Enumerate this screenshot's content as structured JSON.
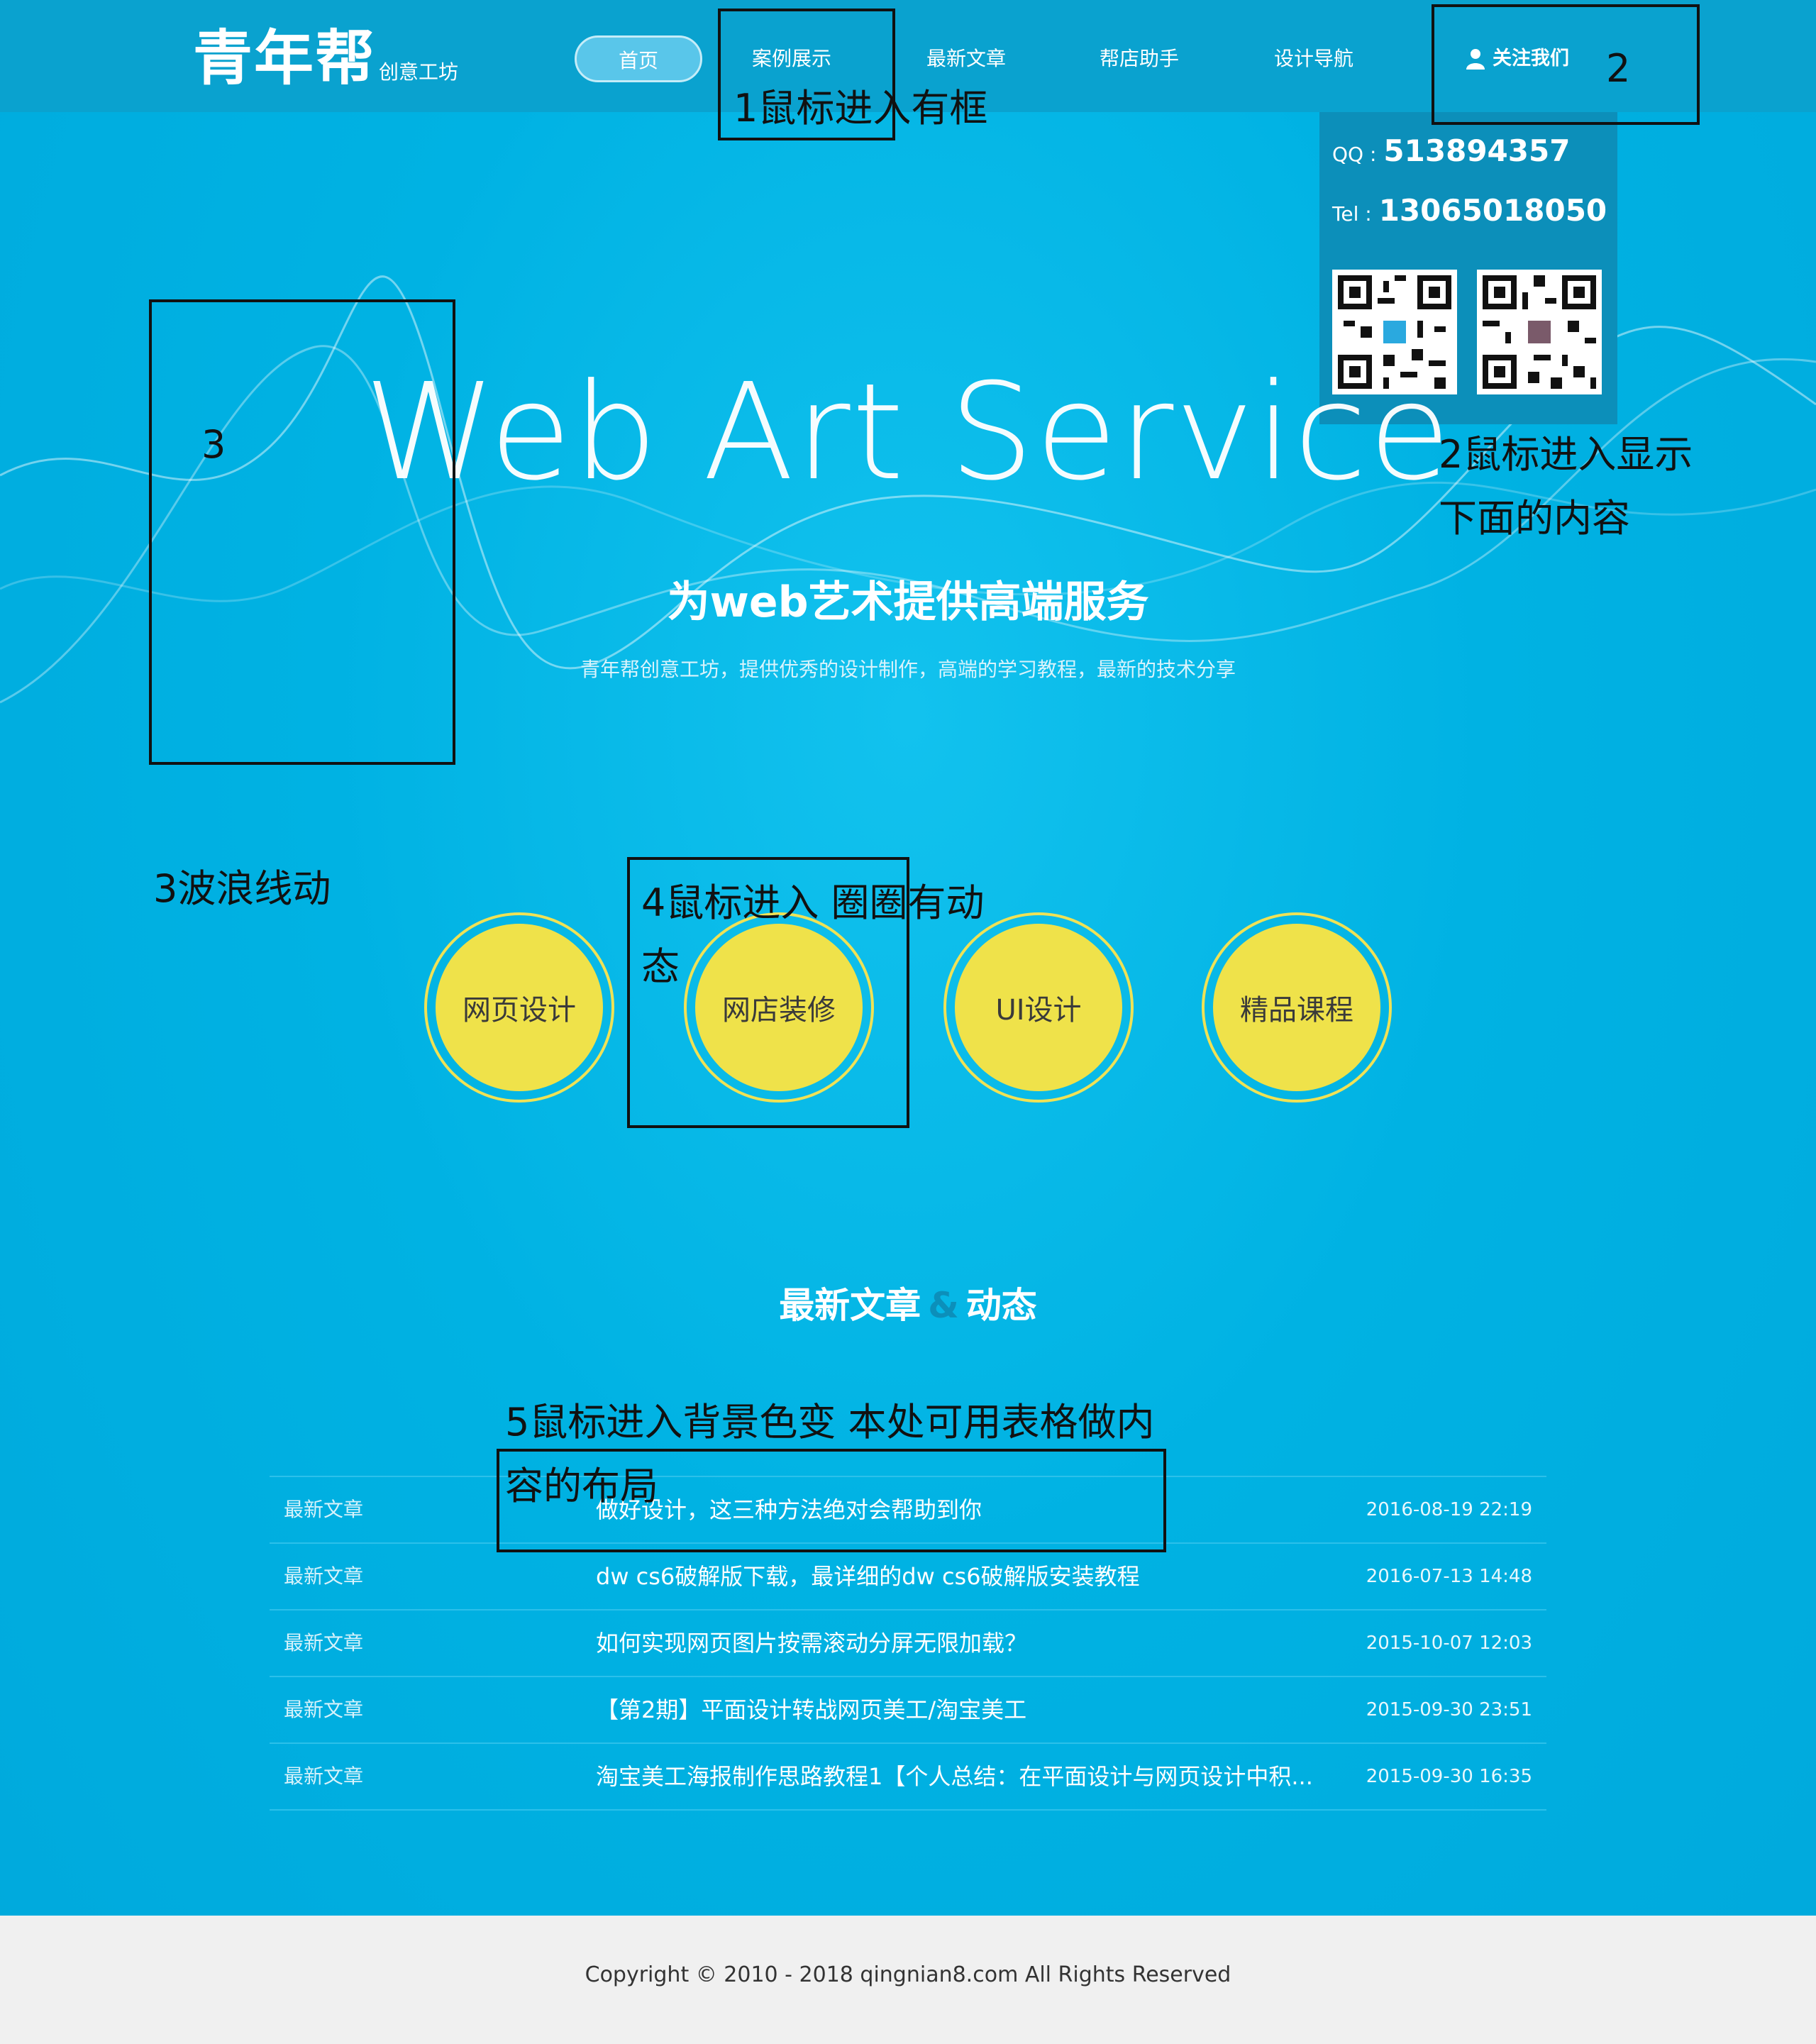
{
  "logo": {
    "main": "青年帮",
    "sub": "创意工坊"
  },
  "nav": [
    {
      "label": "首页"
    },
    {
      "label": "案例展示"
    },
    {
      "label": "最新文章"
    },
    {
      "label": "帮店助手"
    },
    {
      "label": "设计导航"
    }
  ],
  "follow": {
    "label": "关注我们",
    "icon": "user-icon"
  },
  "popup": {
    "qq_label": "QQ :",
    "qq": "513894357",
    "tel_label": "Tel :",
    "tel": "13065018050"
  },
  "hero": {
    "title": "Web Art Service",
    "subtitle": "为web艺术提供高端服务",
    "desc": "青年帮创意工坊，提供优秀的设计制作，高端的学习教程，最新的技术分享"
  },
  "circles": [
    {
      "label": "网页设计"
    },
    {
      "label": "网店装修"
    },
    {
      "label": "UI设计"
    },
    {
      "label": "精品课程"
    }
  ],
  "section": {
    "title_left": "最新文章",
    "amp": "&",
    "title_right": "动态"
  },
  "articles": [
    {
      "cat": "最新文章",
      "title": "做好设计，这三种方法绝对会帮助到你",
      "date": "2016-08-19 22:19"
    },
    {
      "cat": "最新文章",
      "title": "dw cs6破解版下载，最详细的dw cs6破解版安装教程",
      "date": "2016-07-13 14:48"
    },
    {
      "cat": "最新文章",
      "title": "如何实现网页图片按需滚动分屏无限加载？",
      "date": "2015-10-07 12:03"
    },
    {
      "cat": "最新文章",
      "title": "【第2期】平面设计转战网页美工/淘宝美工",
      "date": "2015-09-30 23:51"
    },
    {
      "cat": "最新文章",
      "title": "淘宝美工海报制作思路教程1【个人总结：在平面设计与网页设计中积...",
      "date": "2015-09-30 16:35"
    }
  ],
  "footer": {
    "copyright": "Copyright © 2010 - 2018 qingnian8.com All Rights Reserved"
  },
  "annotations": {
    "a1": "1鼠标进入有框",
    "a2_num": "2",
    "a2": "2鼠标进入显示\n下面的内容",
    "a3_num": "3",
    "a3": "3波浪线动",
    "a4": "4鼠标进入 圈圈有动\n态",
    "a5": "5鼠标进入背景色变  本处可用表格做内\n容的布局"
  },
  "colors": {
    "bg": "#00aee0",
    "header": "#0aa2cf",
    "popup": "#0c8fba",
    "circle": "#efe24a",
    "footer": "#f0f0f0"
  }
}
